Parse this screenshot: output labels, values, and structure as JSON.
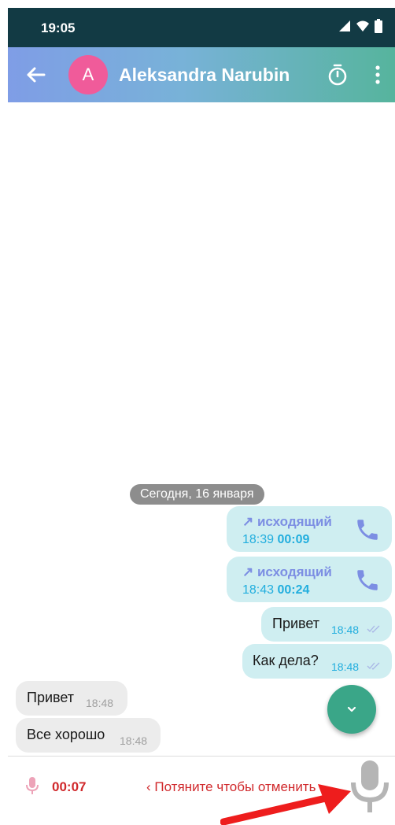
{
  "status_bar": {
    "time": "19:05"
  },
  "header": {
    "avatar_letter": "A",
    "contact_name": "Aleksandra Narubin"
  },
  "date_separator": "Сегодня, 16 января",
  "calls": [
    {
      "direction": "↗ исходящий",
      "time": "18:39",
      "duration": "00:09"
    },
    {
      "direction": "↗ исходящий",
      "time": "18:43",
      "duration": "00:24"
    }
  ],
  "outgoing_messages": [
    {
      "text": "Привет",
      "time": "18:48"
    },
    {
      "text": "Как дела?",
      "time": "18:48"
    }
  ],
  "incoming_messages": [
    {
      "text": "Привет",
      "time": "18:48"
    },
    {
      "text": "Все хорошо",
      "time": "18:48"
    }
  ],
  "recorder": {
    "timer": "00:07",
    "slide_hint": "‹  Потяните чтобы отменить"
  },
  "colors": {
    "accent_teal": "#3aa688",
    "recording_red": "#d0282b",
    "outgoing_bubble": "#cfeef1",
    "incoming_bubble": "#ececec",
    "call_label": "#7c8ee3",
    "time_blue": "#22aede"
  },
  "icons": [
    "back-arrow-icon",
    "timer-icon",
    "more-vert-icon",
    "phone-icon",
    "double-check-icon",
    "chevron-down-icon",
    "mic-icon"
  ]
}
